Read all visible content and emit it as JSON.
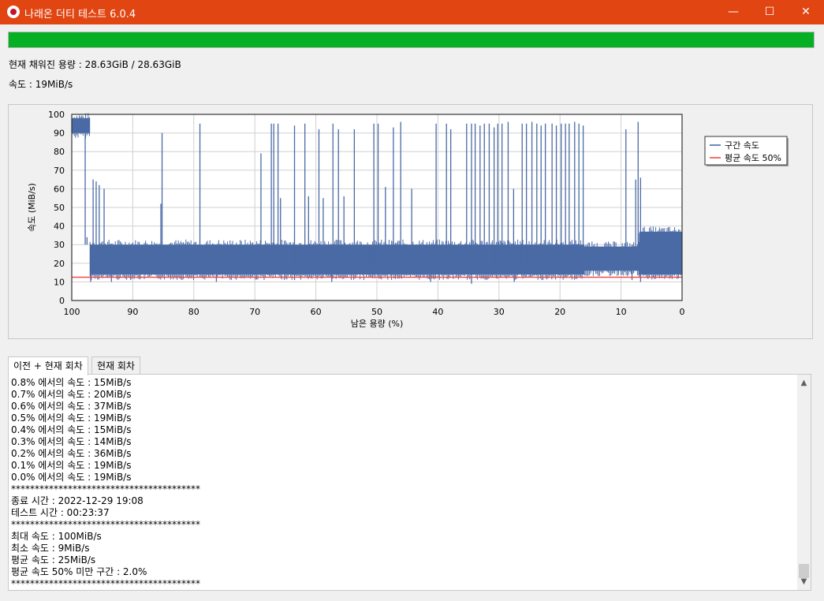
{
  "window": {
    "title": "나래온 더티 테스트 6.0.4",
    "minimize": "—",
    "maximize": "☐",
    "close": "✕"
  },
  "progress": {
    "fraction": 1.0,
    "color": "#06b025"
  },
  "status": {
    "capacity": "현재 채워진 용량 : 28.63GiB / 28.63GiB",
    "speed": "속도 : 19MiB/s"
  },
  "chart_data": {
    "type": "line",
    "ylabel": "속도 (MiB/s)",
    "xlabel": "남은 용량 (%)",
    "xlim": [
      100,
      0
    ],
    "ylim": [
      0,
      100
    ],
    "xticks": [
      100,
      90,
      80,
      70,
      60,
      50,
      40,
      30,
      20,
      10,
      0
    ],
    "yticks": [
      0,
      10,
      20,
      30,
      40,
      50,
      60,
      70,
      80,
      90,
      100
    ],
    "grid": true,
    "legend_position": "right",
    "series": [
      {
        "name": "구간 속도",
        "color": "#4a6aa5"
      },
      {
        "name": "평균 속도 50%",
        "color": "#ef4a4a",
        "value": 12.5
      }
    ],
    "phases": [
      {
        "from": 100,
        "to": 97,
        "low": 90,
        "high": 98
      },
      {
        "from": 97,
        "to": 16,
        "low": 14,
        "high": 30
      },
      {
        "from": 16,
        "to": 7,
        "low": 16,
        "high": 29
      },
      {
        "from": 7,
        "to": 0,
        "low": 14,
        "high": 37
      }
    ],
    "spikes": [
      {
        "x": 96.5,
        "y": 65
      },
      {
        "x": 96,
        "y": 64
      },
      {
        "x": 95.5,
        "y": 62
      },
      {
        "x": 94.7,
        "y": 60
      },
      {
        "x": 85.2,
        "y": 90
      },
      {
        "x": 85.4,
        "y": 52
      },
      {
        "x": 79,
        "y": 95
      },
      {
        "x": 69,
        "y": 79
      },
      {
        "x": 67.3,
        "y": 95
      },
      {
        "x": 66.9,
        "y": 95
      },
      {
        "x": 66.2,
        "y": 95
      },
      {
        "x": 65.8,
        "y": 55
      },
      {
        "x": 63.5,
        "y": 94
      },
      {
        "x": 61.8,
        "y": 95
      },
      {
        "x": 61.2,
        "y": 56
      },
      {
        "x": 59.5,
        "y": 92
      },
      {
        "x": 58.8,
        "y": 55
      },
      {
        "x": 57.2,
        "y": 95
      },
      {
        "x": 56.3,
        "y": 92
      },
      {
        "x": 55.4,
        "y": 56
      },
      {
        "x": 53.7,
        "y": 92
      },
      {
        "x": 50.5,
        "y": 95
      },
      {
        "x": 49.8,
        "y": 95
      },
      {
        "x": 48.6,
        "y": 61
      },
      {
        "x": 47.3,
        "y": 93
      },
      {
        "x": 46.1,
        "y": 96
      },
      {
        "x": 44.3,
        "y": 60
      },
      {
        "x": 40.3,
        "y": 95
      },
      {
        "x": 38.6,
        "y": 95
      },
      {
        "x": 37.9,
        "y": 92
      },
      {
        "x": 35.3,
        "y": 95
      },
      {
        "x": 34.5,
        "y": 95
      },
      {
        "x": 33.9,
        "y": 95
      },
      {
        "x": 33.1,
        "y": 94
      },
      {
        "x": 32.4,
        "y": 95
      },
      {
        "x": 31.6,
        "y": 95
      },
      {
        "x": 30.8,
        "y": 93
      },
      {
        "x": 30.2,
        "y": 95
      },
      {
        "x": 29.5,
        "y": 95
      },
      {
        "x": 28.5,
        "y": 96
      },
      {
        "x": 27.6,
        "y": 60
      },
      {
        "x": 26.2,
        "y": 95
      },
      {
        "x": 25.5,
        "y": 95
      },
      {
        "x": 24.6,
        "y": 96
      },
      {
        "x": 23.8,
        "y": 95
      },
      {
        "x": 23.1,
        "y": 94
      },
      {
        "x": 22.4,
        "y": 95
      },
      {
        "x": 21.3,
        "y": 95
      },
      {
        "x": 20.6,
        "y": 94
      },
      {
        "x": 19.8,
        "y": 95
      },
      {
        "x": 19.1,
        "y": 95
      },
      {
        "x": 18.5,
        "y": 95
      },
      {
        "x": 17.6,
        "y": 96
      },
      {
        "x": 16.9,
        "y": 95
      },
      {
        "x": 16.2,
        "y": 94
      },
      {
        "x": 9.2,
        "y": 92
      },
      {
        "x": 7.6,
        "y": 65
      },
      {
        "x": 7.2,
        "y": 96
      },
      {
        "x": 6.8,
        "y": 66
      }
    ],
    "dips": [
      {
        "x": 97.8,
        "y": 92
      },
      {
        "x": 97.5,
        "y": 34
      },
      {
        "x": 96.9,
        "y": 10
      },
      {
        "x": 93.5,
        "y": 10
      },
      {
        "x": 76.3,
        "y": 10
      },
      {
        "x": 63.5,
        "y": 11
      },
      {
        "x": 57.4,
        "y": 10
      },
      {
        "x": 41.2,
        "y": 10
      },
      {
        "x": 34.5,
        "y": 9
      },
      {
        "x": 27.5,
        "y": 10
      },
      {
        "x": 8.2,
        "y": 11
      },
      {
        "x": 6.8,
        "y": 10
      }
    ]
  },
  "tabs": [
    {
      "label": "이전 + 현재 회차",
      "active": true
    },
    {
      "label": "현재 회차",
      "active": false
    }
  ],
  "log": [
    "0.8% 에서의 속도 : 15MiB/s",
    "0.7% 에서의 속도 : 20MiB/s",
    "0.6% 에서의 속도 : 37MiB/s",
    "0.5% 에서의 속도 : 19MiB/s",
    "0.4% 에서의 속도 : 15MiB/s",
    "0.3% 에서의 속도 : 14MiB/s",
    "0.2% 에서의 속도 : 36MiB/s",
    "0.1% 에서의 속도 : 19MiB/s",
    "0.0% 에서의 속도 : 19MiB/s",
    "****************************************",
    "종료 시간 : 2022-12-29 19:08",
    "테스트 시간 : 00:23:37",
    "****************************************",
    "최대 속도 : 100MiB/s",
    "최소 속도 : 9MiB/s",
    "평균 속도 : 25MiB/s",
    "평균 속도 50% 미만 구간 : 2.0%",
    "****************************************"
  ],
  "scrollbar": {
    "up": "▲",
    "down": "▼"
  }
}
